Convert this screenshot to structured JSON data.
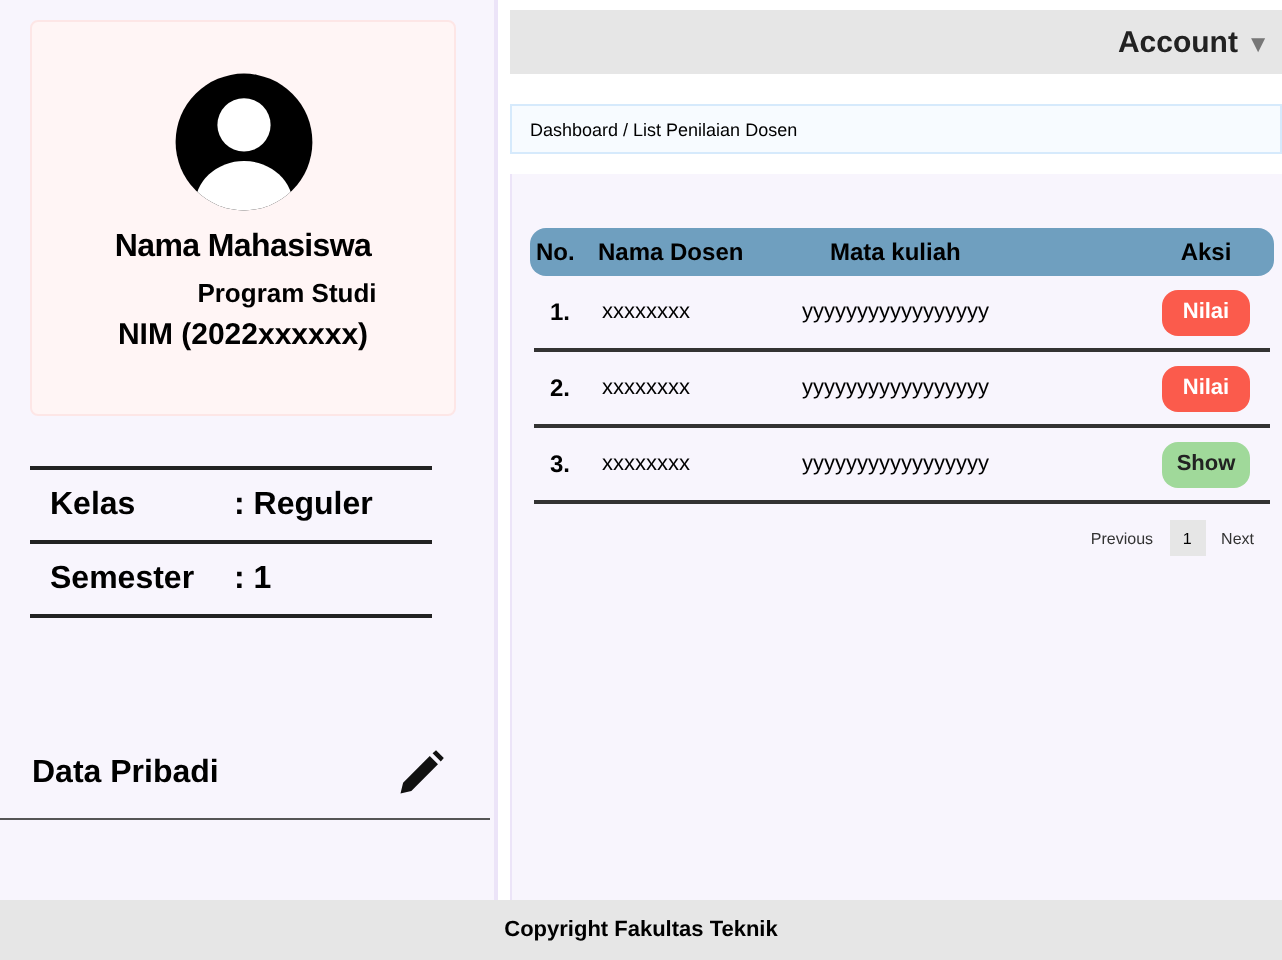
{
  "profile": {
    "name": "Nama Mahasiswa",
    "program": "Program Studi",
    "nim": "NIM (2022xxxxxx)"
  },
  "info": [
    {
      "label": "Kelas",
      "value": ": Reguler"
    },
    {
      "label": "Semester",
      "value": ": 1"
    }
  ],
  "personal": {
    "label": "Data Pribadi"
  },
  "header": {
    "account": "Account",
    "caret": "▼"
  },
  "breadcrumb": "Dashboard / List Penilaian Dosen",
  "table": {
    "columns": [
      "No.",
      "Nama Dosen",
      "Mata kuliah",
      "Aksi"
    ],
    "rows": [
      {
        "no": "1.",
        "dosen": "xxxxxxxx",
        "matkul": "yyyyyyyyyyyyyyyyy",
        "action": {
          "label": "Nilai",
          "kind": "nilai"
        }
      },
      {
        "no": "2.",
        "dosen": "xxxxxxxx",
        "matkul": "yyyyyyyyyyyyyyyyy",
        "action": {
          "label": "Nilai",
          "kind": "nilai"
        }
      },
      {
        "no": "3.",
        "dosen": "xxxxxxxx",
        "matkul": "yyyyyyyyyyyyyyyyy",
        "action": {
          "label": "Show",
          "kind": "show"
        }
      }
    ]
  },
  "pagination": {
    "previous": "Previous",
    "pages": [
      {
        "label": "1",
        "selected": true
      }
    ],
    "next": "Next"
  },
  "footer": "Copyright Fakultas Teknik"
}
